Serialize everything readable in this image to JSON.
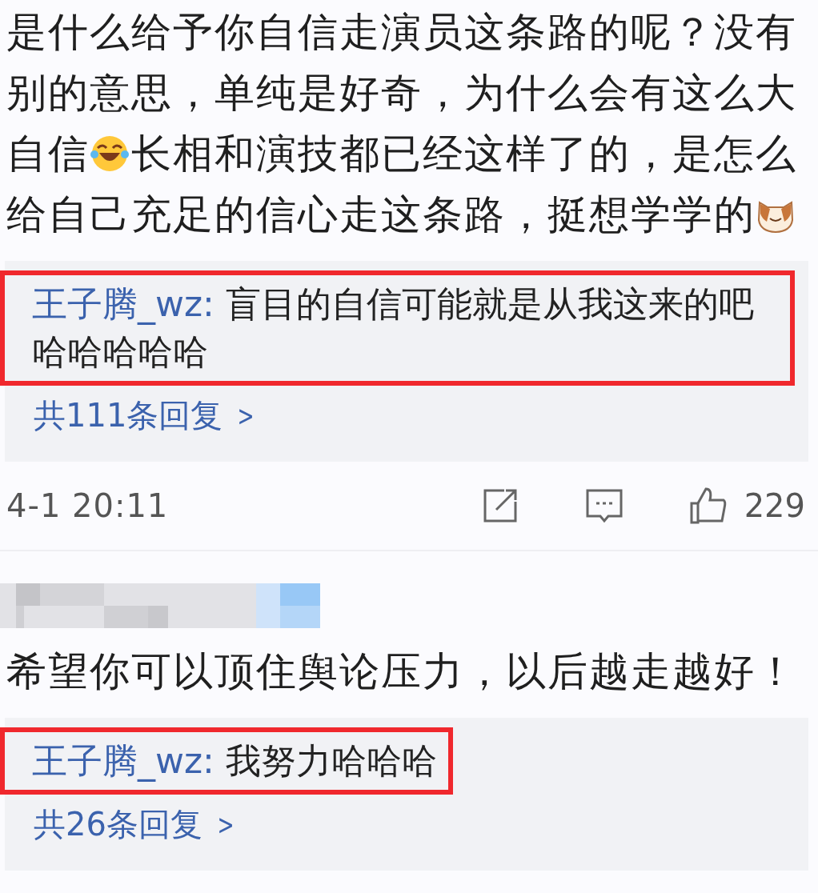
{
  "comments": [
    {
      "author_blurred": false,
      "lines": [
        [
          {
            "kind": "text",
            "text": "是什么给予你自信走演员这条路的呢？没有"
          }
        ],
        [
          {
            "kind": "text",
            "text": "别的意思，单纯是好奇，为什么会有这么大"
          }
        ],
        [
          {
            "kind": "text",
            "text": "自信"
          },
          {
            "kind": "laugh_emoji"
          },
          {
            "kind": "text",
            "text": "长相和演技都已经这样了的，是怎么"
          }
        ],
        [
          {
            "kind": "text",
            "text": "给自己充足的信心走这条路，挺想学学的"
          },
          {
            "kind": "cat_emoji"
          }
        ]
      ],
      "reply": {
        "author": "王子腾_wz:",
        "text": "盲目的自信可能就是从我这来的吧哈哈哈哈哈",
        "highlighted": true
      },
      "reply_count": "共111条回复",
      "chevron": ">",
      "footer": {
        "time": "4-1 20:11",
        "likes": "229"
      }
    },
    {
      "author_blurred": true,
      "lines": [
        [
          {
            "kind": "text",
            "text": "希望你可以顶住舆论压力，以后越走越好！"
          }
        ]
      ],
      "reply": {
        "author": "王子腾_wz:",
        "text": "我努力哈哈哈",
        "highlighted": true
      },
      "reply_count": "共26条回复",
      "chevron": ">"
    }
  ]
}
